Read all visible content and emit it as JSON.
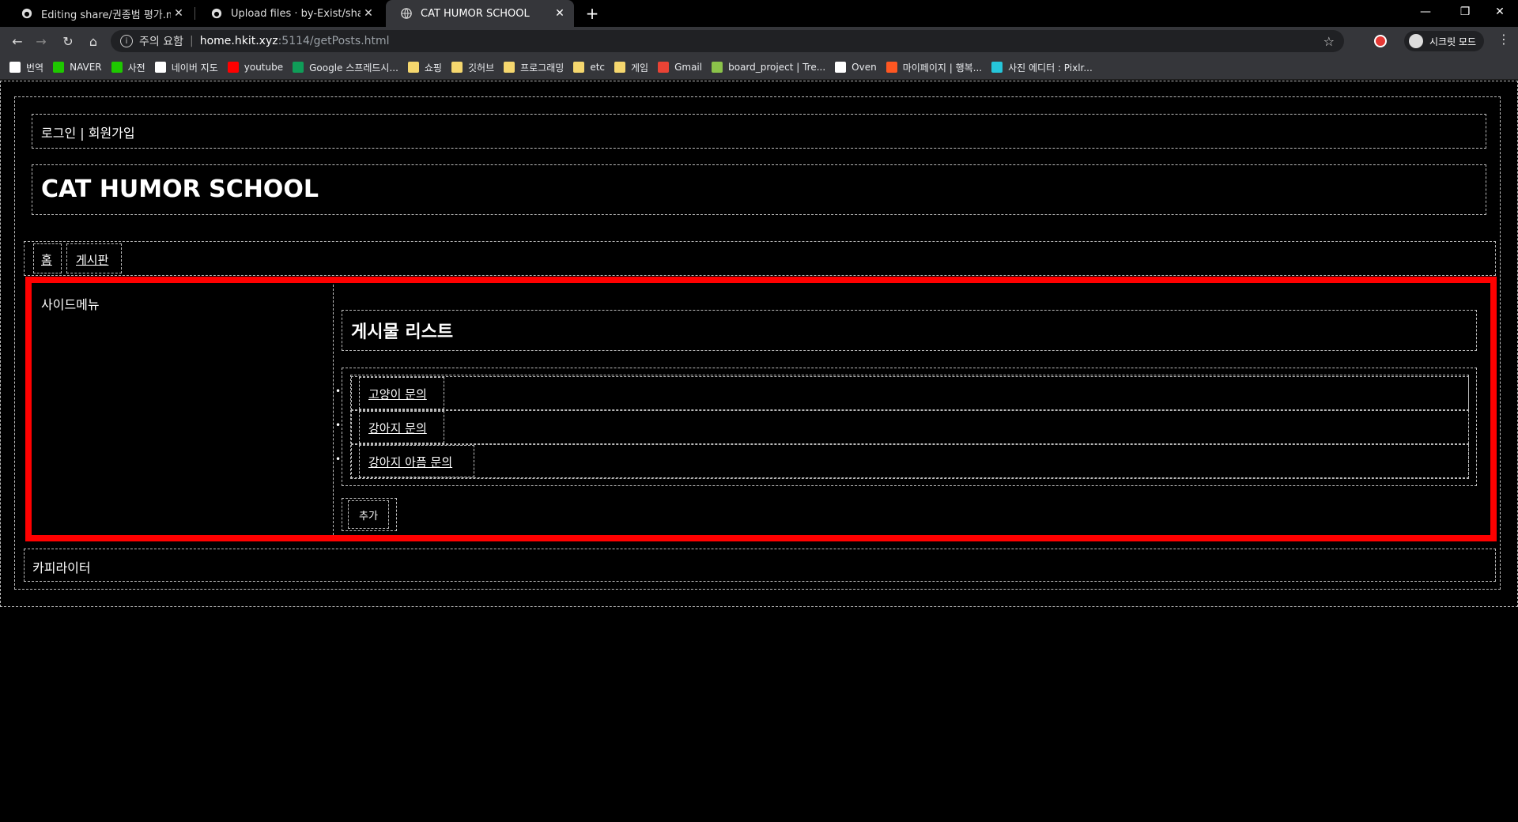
{
  "browser": {
    "tabs": [
      {
        "title": "Editing share/권종범 평가.md at",
        "active": false,
        "icon": "github-icon"
      },
      {
        "title": "Upload files · by-Exist/share",
        "active": false,
        "icon": "github-icon"
      },
      {
        "title": "CAT HUMOR SCHOOL",
        "active": true,
        "icon": "globe-icon"
      }
    ],
    "security_label": "주의 요함",
    "url_host": "home.hkit.xyz",
    "url_path": ":5114/getPosts.html",
    "incognito_label": "시크릿 모드",
    "bookmarks": [
      {
        "label": "번역",
        "icon": "google-translate-icon",
        "color": "#ffffff"
      },
      {
        "label": "NAVER",
        "icon": "naver-icon",
        "color": "#1ec800"
      },
      {
        "label": "사전",
        "icon": "naver-dict-icon",
        "color": "#1ec800"
      },
      {
        "label": "네이버 지도",
        "icon": "naver-map-icon",
        "color": "#ffffff"
      },
      {
        "label": "youtube",
        "icon": "youtube-icon",
        "color": "#ff0000"
      },
      {
        "label": "Google 스프레드시...",
        "icon": "sheets-icon",
        "color": "#0f9d58"
      },
      {
        "label": "쇼핑",
        "icon": "folder-icon",
        "color": "#f5d76e"
      },
      {
        "label": "깃허브",
        "icon": "folder-icon",
        "color": "#f5d76e"
      },
      {
        "label": "프로그래밍",
        "icon": "folder-icon",
        "color": "#f5d76e"
      },
      {
        "label": "etc",
        "icon": "folder-icon",
        "color": "#f5d76e"
      },
      {
        "label": "게임",
        "icon": "folder-icon",
        "color": "#f5d76e"
      },
      {
        "label": "Gmail",
        "icon": "gmail-icon",
        "color": "#ea4335"
      },
      {
        "label": "board_project | Tre...",
        "icon": "trello-icon",
        "color": "#8bc34a"
      },
      {
        "label": "Oven",
        "icon": "oven-icon",
        "color": "#ffffff"
      },
      {
        "label": "마이페이지 | 행복...",
        "icon": "happy-icon",
        "color": "#ff5722"
      },
      {
        "label": "사진 에디터 : Pixlr...",
        "icon": "pixlr-icon",
        "color": "#26c6da"
      }
    ]
  },
  "site": {
    "auth_links": "로그인 | 회원가입",
    "title": "CAT HUMOR SCHOOL",
    "nav": [
      "홈",
      "게시판"
    ],
    "side_menu": "사이드메뉴",
    "list_title": "게시물 리스트",
    "posts": [
      "고양이 문의",
      "강아지 문의",
      "강아지 아픔 문의"
    ],
    "add_button": "추가",
    "footer": "카피라이터",
    "accent_color": "#ff0000"
  }
}
